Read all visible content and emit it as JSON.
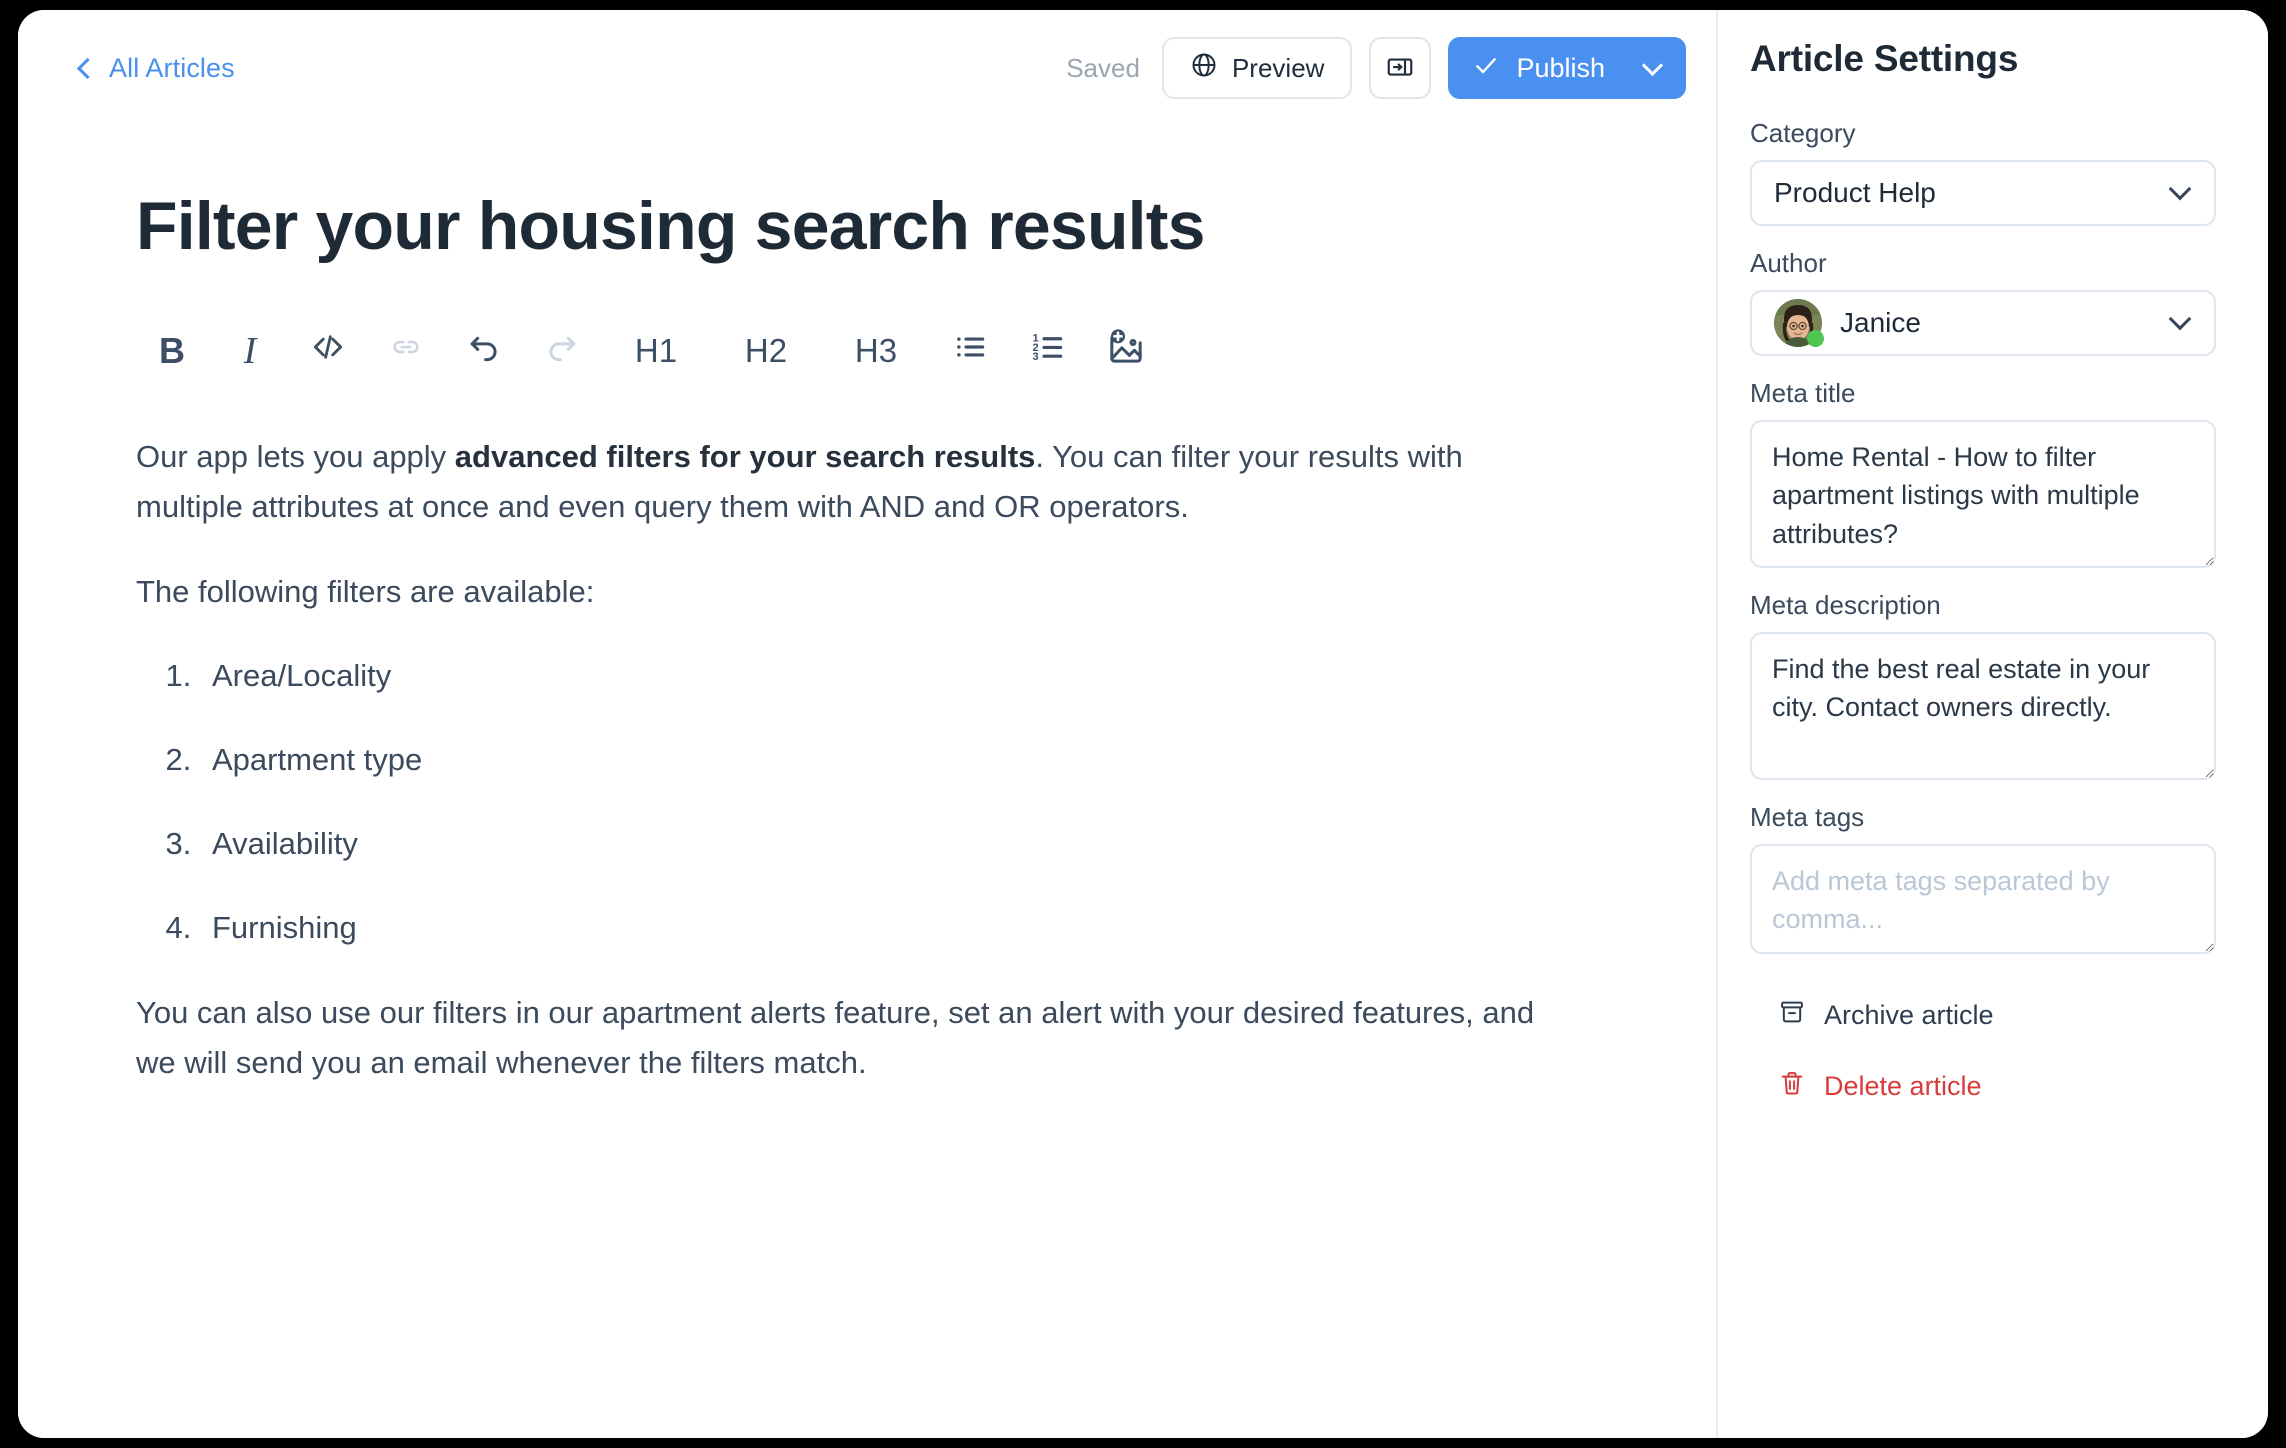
{
  "topbar": {
    "back_label": "All Articles",
    "back_icon": "chevron-left-icon",
    "saved_status": "Saved",
    "preview_label": "Preview",
    "preview_icon": "globe-icon",
    "panel_toggle_icon": "panel-right-icon",
    "publish_label": "Publish",
    "publish_icon": "check-icon",
    "publish_caret_icon": "chevron-down-icon",
    "publish_color": "#4A90F0"
  },
  "article": {
    "title": "Filter your housing search results",
    "toolbar": [
      {
        "name": "bold",
        "label": "B",
        "icon": "bold-icon",
        "disabled": false
      },
      {
        "name": "italic",
        "label": "I",
        "icon": "italic-icon",
        "disabled": false
      },
      {
        "name": "code",
        "label": "</>",
        "icon": "code-icon",
        "disabled": false
      },
      {
        "name": "link",
        "label": "",
        "icon": "link-icon",
        "disabled": true
      },
      {
        "name": "undo",
        "label": "",
        "icon": "undo-icon",
        "disabled": false
      },
      {
        "name": "redo",
        "label": "",
        "icon": "redo-icon",
        "disabled": true
      },
      {
        "name": "h1",
        "label": "H1",
        "icon": "heading-1-icon",
        "disabled": false
      },
      {
        "name": "h2",
        "label": "H2",
        "icon": "heading-2-icon",
        "disabled": false
      },
      {
        "name": "h3",
        "label": "H3",
        "icon": "heading-3-icon",
        "disabled": false
      },
      {
        "name": "bullet-list",
        "label": "",
        "icon": "bulleted-list-icon",
        "disabled": false
      },
      {
        "name": "numbered-list",
        "label": "",
        "icon": "numbered-list-icon",
        "disabled": false
      },
      {
        "name": "insert-image",
        "label": "",
        "icon": "add-image-icon",
        "disabled": false
      }
    ],
    "paragraph_1_before": "Our app lets you apply ",
    "paragraph_1_bold": "advanced filters for your search results",
    "paragraph_1_after": ". You can filter your results with multiple attributes at once and even query them with AND and OR operators.",
    "paragraph_2": "The following filters are available:",
    "filter_list": [
      "Area/Locality",
      "Apartment type",
      "Availability",
      "Furnishing"
    ],
    "paragraph_3": "You can also use our filters in our apartment alerts feature, set an alert with your desired features, and we will send you an email whenever the filters match."
  },
  "settings": {
    "panel_title": "Article Settings",
    "category_label": "Category",
    "category_value": "Product Help",
    "author_label": "Author",
    "author_value": "Janice",
    "author_status": "online",
    "meta_title_label": "Meta title",
    "meta_title_value": "Home Rental - How to filter apartment listings with multiple attributes?",
    "meta_description_label": "Meta description",
    "meta_description_value": "Find the best real estate in your city. Contact owners directly.",
    "meta_tags_label": "Meta tags",
    "meta_tags_value": "",
    "meta_tags_placeholder": "Add meta tags separated by comma...",
    "archive_label": "Archive article",
    "archive_icon": "archive-icon",
    "delete_label": "Delete article",
    "delete_icon": "trash-icon",
    "delete_color": "#D93B3B"
  }
}
